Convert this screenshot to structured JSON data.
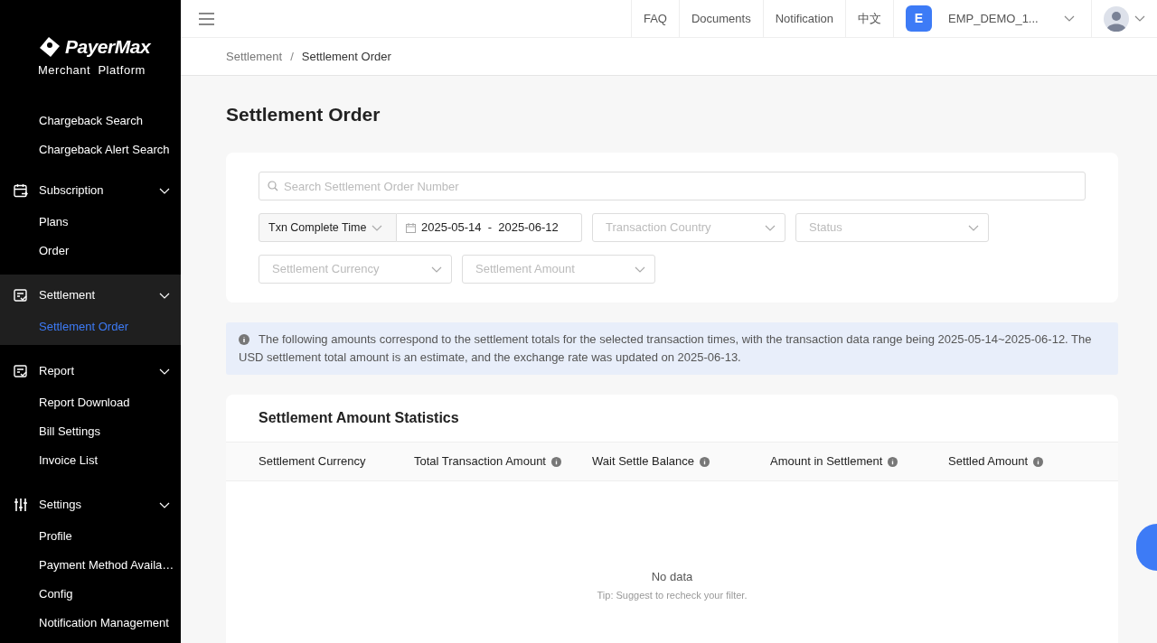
{
  "logo": {
    "brand": "PayerMax",
    "subtitle": "Merchant  Platform"
  },
  "sidebar": {
    "items": [
      {
        "kind": "link",
        "label": "Chargeback Search",
        "selected": false
      },
      {
        "kind": "link",
        "label": "Chargeback Alert Search",
        "selected": false
      },
      {
        "kind": "group",
        "label": "Subscription",
        "expanded": true,
        "selected": false,
        "children": [
          {
            "label": "Plans",
            "selected": false
          },
          {
            "label": "Order",
            "selected": false
          }
        ]
      },
      {
        "kind": "group",
        "label": "Settlement",
        "expanded": true,
        "selected": true,
        "children": [
          {
            "label": "Settlement Order",
            "selected": true
          }
        ]
      },
      {
        "kind": "group",
        "label": "Report",
        "expanded": true,
        "selected": false,
        "children": [
          {
            "label": "Report Download",
            "selected": false
          },
          {
            "label": "Bill Settings",
            "selected": false
          },
          {
            "label": "Invoice List",
            "selected": false
          }
        ]
      },
      {
        "kind": "group",
        "label": "Settings",
        "expanded": true,
        "selected": false,
        "children": [
          {
            "label": "Profile",
            "selected": false
          },
          {
            "label": "Payment Method Availa…",
            "selected": false
          },
          {
            "label": "Config",
            "selected": false
          },
          {
            "label": "Notification Management",
            "selected": false
          }
        ]
      }
    ]
  },
  "topbar": {
    "links": [
      "FAQ",
      "Documents",
      "Notification",
      "中文"
    ],
    "account": {
      "initial": "E",
      "name": "EMP_DEMO_1..."
    }
  },
  "breadcrumb": {
    "items": [
      "Settlement",
      "Settlement Order"
    ],
    "separator": "/"
  },
  "page_title": "Settlement Order",
  "filters": {
    "search": {
      "placeholder": "Search Settlement Order Number"
    },
    "date_type": "Txn Complete Time",
    "date_start": "2025-05-14",
    "date_separator": "-",
    "date_end": "2025-06-12",
    "row_2": [
      {
        "placeholder": "Transaction Country"
      },
      {
        "placeholder": "Status"
      }
    ],
    "row_3": [
      {
        "placeholder": "Settlement Currency"
      },
      {
        "placeholder": "Settlement Amount"
      }
    ]
  },
  "notice": "The following amounts correspond to the settlement totals for the selected transaction times, with the transaction data range being 2025-05-14~2025-06-12. The USD settlement total amount is an estimate, and the exchange rate was updated on 2025-06-13.",
  "statistics": {
    "title": "Settlement Amount Statistics",
    "columns": [
      {
        "label": "Settlement Currency",
        "info": false
      },
      {
        "label": "Total Transaction Amount",
        "info": true
      },
      {
        "label": "Wait Settle Balance",
        "info": true
      },
      {
        "label": "Amount in Settlement",
        "info": true
      },
      {
        "label": "Settled Amount",
        "info": true
      }
    ],
    "empty": {
      "title": "No data",
      "tip": "Tip: Suggest to recheck your filter."
    }
  }
}
